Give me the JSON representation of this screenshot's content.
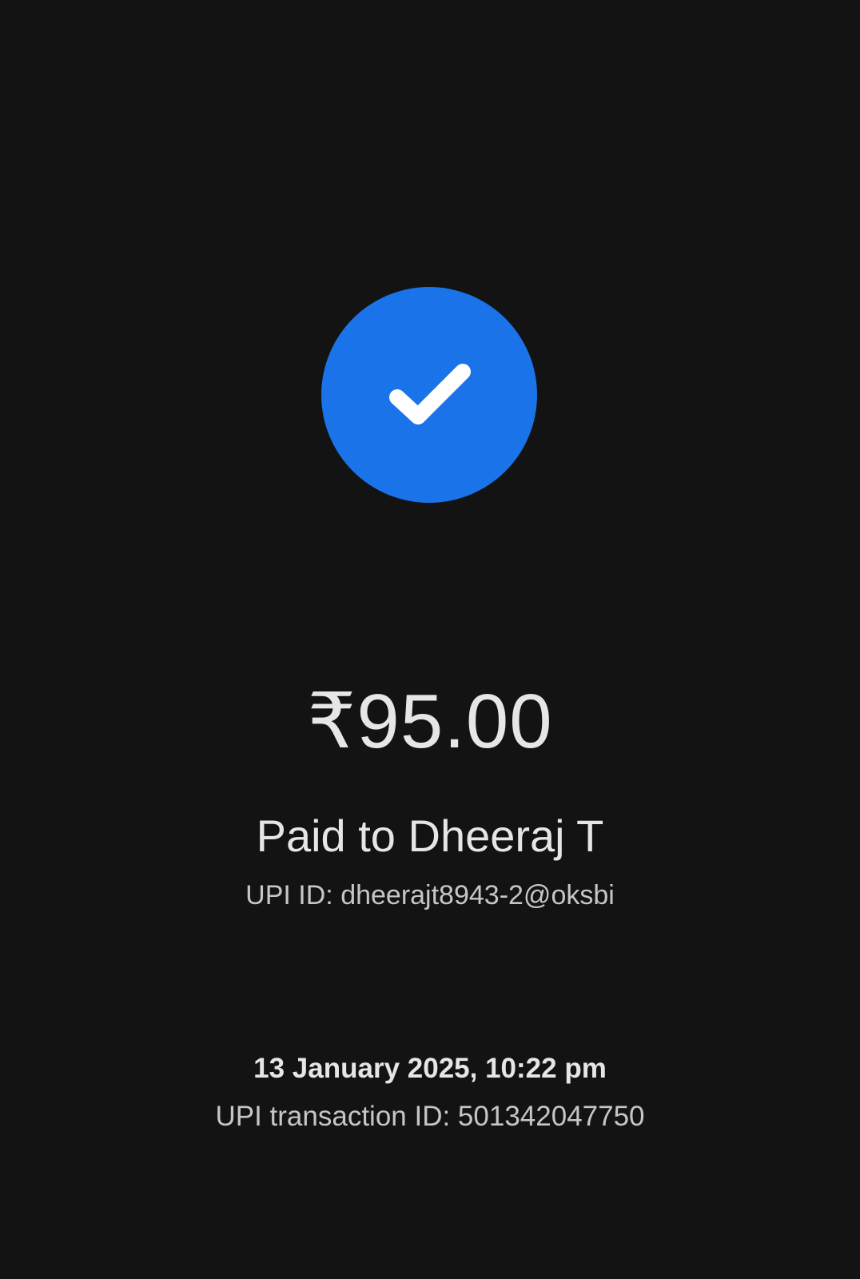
{
  "status": {
    "icon": "check-icon",
    "accent_color": "#1a73e8"
  },
  "payment": {
    "amount": "₹95.00",
    "paid_to": "Paid to Dheeraj T",
    "upi_id": "UPI ID: dheerajt8943-2@oksbi",
    "datetime": "13 January 2025, 10:22 pm",
    "transaction_id": "UPI transaction ID: 501342047750"
  }
}
